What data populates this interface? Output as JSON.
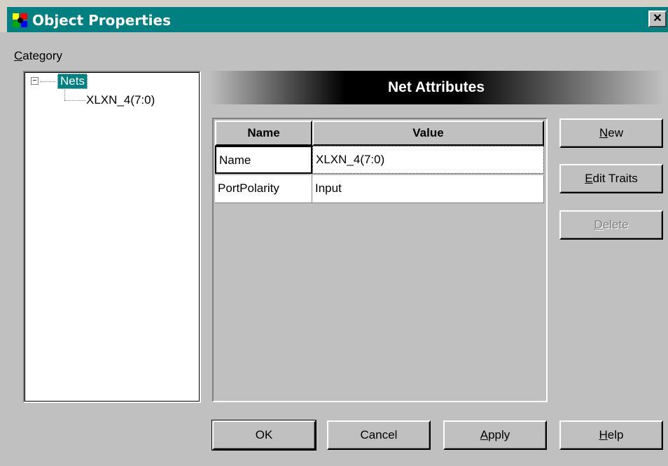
{
  "window": {
    "title": "Object Properties",
    "close_glyph": "✕"
  },
  "category": {
    "label_mnemonic": "C",
    "label_rest": "ategory",
    "tree": {
      "expander": "−",
      "root": "Nets",
      "child": "XLXN_4(7:0)"
    }
  },
  "banner": {
    "title": "Net Attributes"
  },
  "grid": {
    "headers": [
      "Name",
      "Value"
    ],
    "rows": [
      {
        "name": "Name",
        "value": "XLXN_4(7:0)"
      },
      {
        "name": "PortPolarity",
        "value": "Input"
      }
    ]
  },
  "side_buttons": {
    "new_mnemonic": "N",
    "new_rest": "ew",
    "edit_mnemonic": "E",
    "edit_rest": "dit Traits",
    "delete_mnemonic": "D",
    "delete_rest": "elete"
  },
  "bottom_buttons": {
    "ok": "OK",
    "cancel": "Cancel",
    "apply_mnemonic": "A",
    "apply_rest": "pply",
    "help_mnemonic": "H",
    "help_rest": "elp"
  },
  "colors": {
    "titlebar": "#008080",
    "face": "#c0c0c0",
    "selection": "#008080"
  },
  "icons": {
    "app": "app-icon",
    "close": "close-icon"
  }
}
